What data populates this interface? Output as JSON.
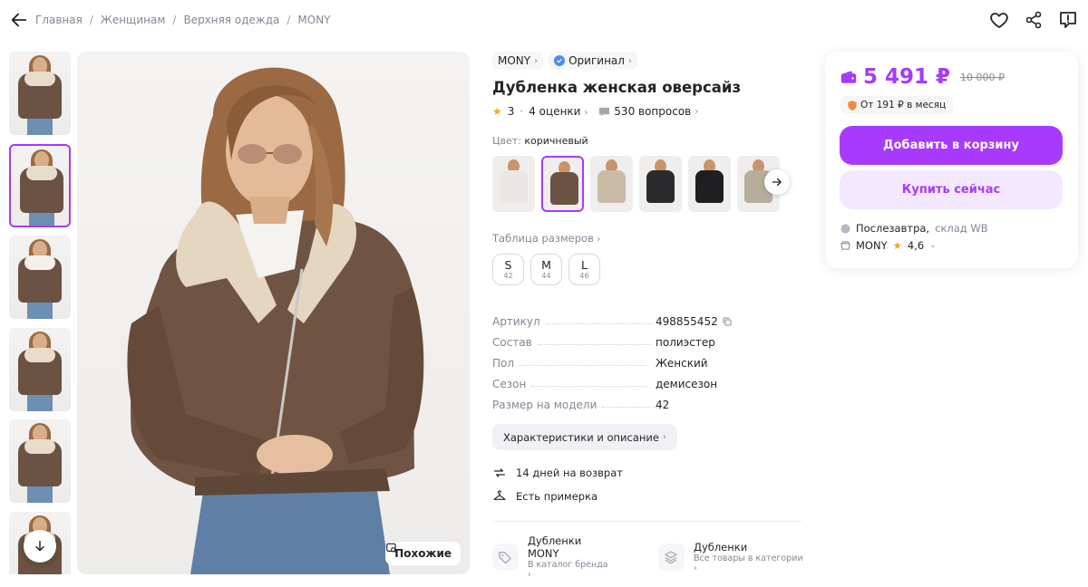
{
  "breadcrumbs": [
    "Главная",
    "Женщинам",
    "Верхняя одежда",
    "MONY"
  ],
  "product": {
    "brand": "MONY",
    "original_label": "Оригинал",
    "title": "Дубленка женская оверсайз",
    "rating": "3",
    "reviews": "4 оценки",
    "questions": "530 вопросов",
    "color_label": "Цвет:",
    "color_value": "коричневый",
    "size_table": "Таблица размеров",
    "sizes": [
      {
        "label": "S",
        "ru": "42"
      },
      {
        "label": "M",
        "ru": "44"
      },
      {
        "label": "L",
        "ru": "46"
      }
    ],
    "specs": [
      {
        "key": "Артикул",
        "value": "498855452"
      },
      {
        "key": "Состав",
        "value": "полиэстер"
      },
      {
        "key": "Пол",
        "value": "Женский"
      },
      {
        "key": "Сезон",
        "value": "демисезон"
      },
      {
        "key": "Размер на модели",
        "value": "42"
      }
    ],
    "description_button": "Характеристики и описание",
    "perks": [
      "14 дней на возврат",
      "Есть примерка"
    ],
    "links": [
      {
        "title": "Дубленки MONY",
        "subtitle": "В каталог бренда"
      },
      {
        "title": "Дубленки",
        "subtitle": "Все товары в категории"
      }
    ]
  },
  "photo": {
    "similar_label": "Похожие"
  },
  "price_card": {
    "price": "5 491 ₽",
    "old_price": "10 000 ₽",
    "installment": "От 191 ₽ в месяц",
    "add_to_cart": "Добавить в корзину",
    "buy_now": "Купить сейчас",
    "delivery_day": "Послезавтра,",
    "delivery_place": "склад WB",
    "seller": "MONY",
    "seller_rating": "4,6"
  },
  "colors": {
    "accent": "#a73afd",
    "accent_light": "#f4e8ff",
    "star": "#f5a623",
    "verified": "#4d8bf1"
  },
  "swatch_colors": [
    "#e9e7e4",
    "#6b5242",
    "#c9bba5",
    "#2b2b2d",
    "#1f1f21",
    "#b8ad9c"
  ]
}
